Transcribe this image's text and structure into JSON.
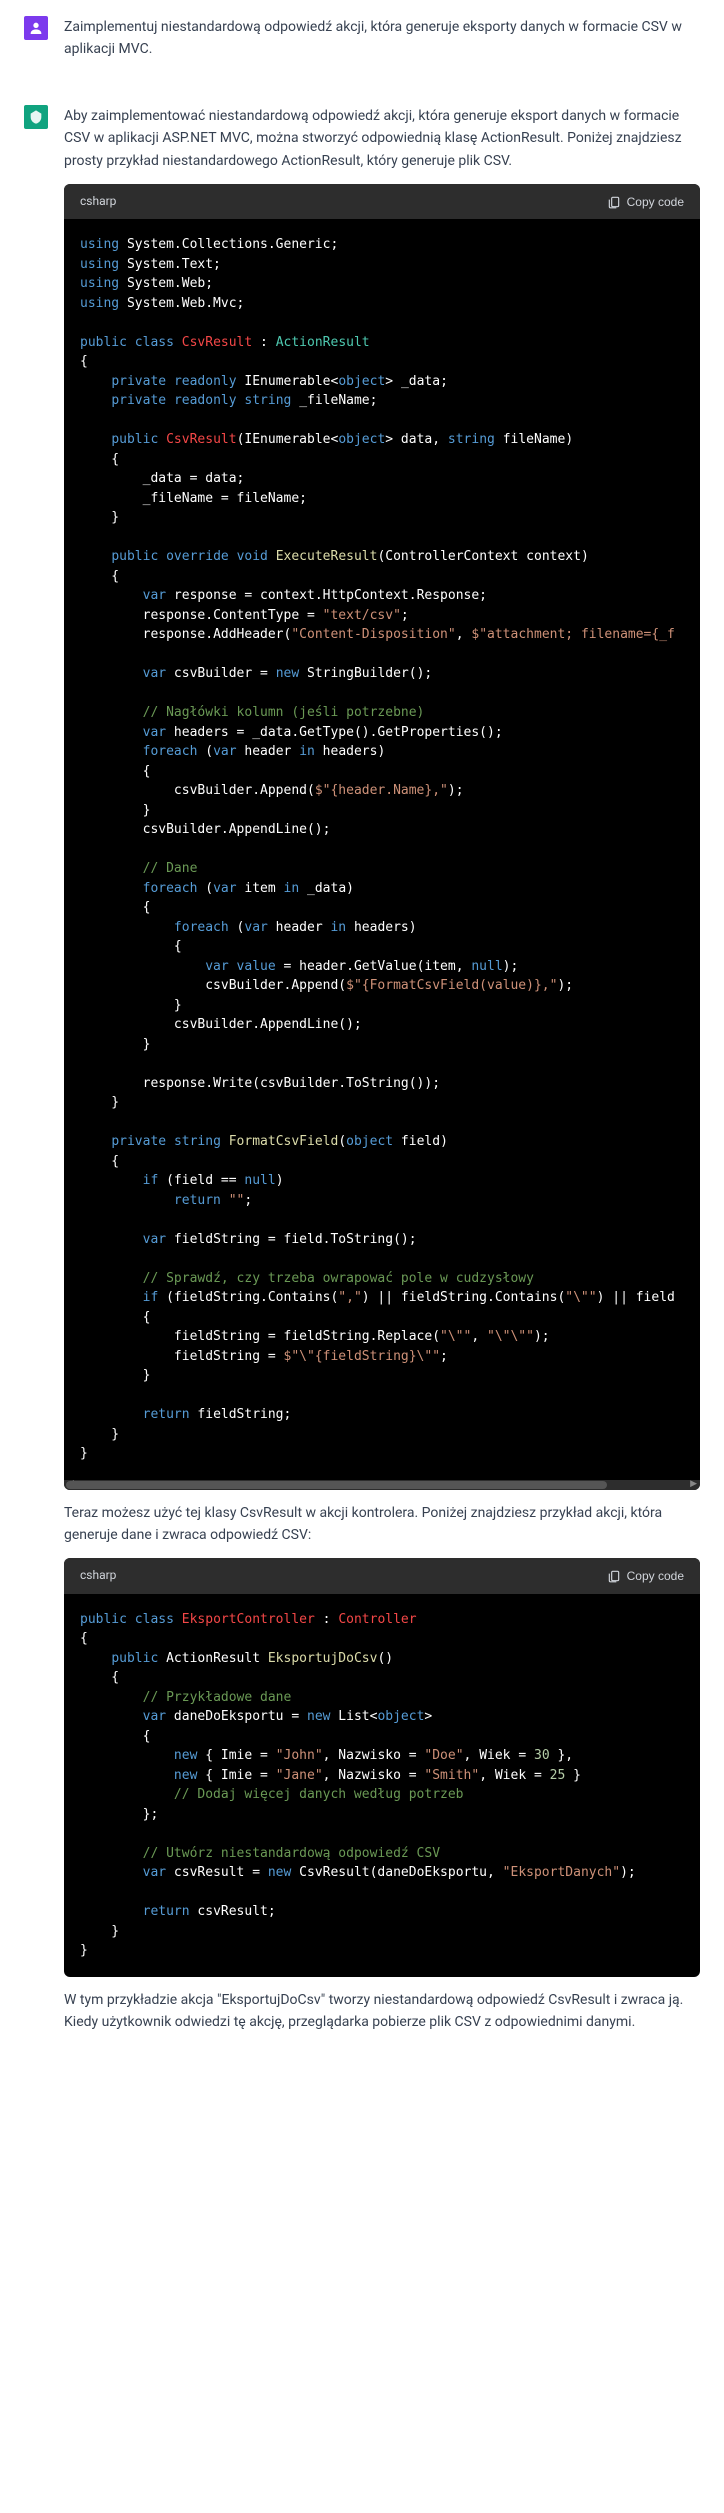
{
  "user": {
    "prompt": "Zaimplementuj niestandardową odpowiedź akcji, która generuje eksporty danych w formacie CSV w aplikacji MVC."
  },
  "assistant": {
    "intro": "Aby zaimplementować niestandardową odpowiedź akcji, która generuje eksport danych w formacie CSV w aplikacji ASP.NET MVC, można stworzyć odpowiednią klasę ActionResult. Poniżej znajdziesz prosty przykład niestandardowego ActionResult, który generuje plik CSV.",
    "mid": "Teraz możesz użyć tej klasy CsvResult w akcji kontrolera. Poniżej znajdziesz przykład akcji, która generuje dane i zwraca odpowiedź CSV:",
    "outro": "W tym przykładzie akcja \"EksportujDoCsv\" tworzy niestandardową odpowiedź CsvResult i zwraca ją. Kiedy użytkownik odwiedzi tę akcję, przeglądarka pobierze plik CSV z odpowiednimi danymi."
  },
  "code": {
    "lang": "csharp",
    "copy": "Copy code"
  },
  "code1": {
    "u1": "System.Collections.Generic;",
    "u2": "System.Text;",
    "u3": "System.Web;",
    "u4": "System.Web.Mvc;",
    "cls": "CsvResult",
    "ext": "ActionResult",
    "dataField": "_data;",
    "fileField": "_fileName;",
    "ctor": "CsvResult",
    "ctorParams": "> data, ",
    "ctorParam2": " fileName)",
    "d1": "_data = data;",
    "d2": "_fileName = fileName;",
    "exec": "ExecuteResult",
    "execParam": "(ControllerContext context)",
    "r1": " response = context.HttpContext.Response;",
    "r2": "response.ContentType = ",
    "r2s": "\"text/csv\"",
    "r3": "response.AddHeader(",
    "r3a": "\"Content-Disposition\"",
    "r3b": "$\"attachment; filename={_f",
    "sb": " csvBuilder = ",
    "sb2": " StringBuilder();",
    "c1": "// Nagłówki kolumn (jeśli potrzebne)",
    "h1": " headers = _data.GetType().GetProperties();",
    "fe1": " header ",
    "fe1b": " headers)",
    "ap1": "csvBuilder.Append(",
    "ap1s": "$\"{header.Name},\"",
    "apl": "csvBuilder.AppendLine();",
    "c2": "// Dane",
    "fe2": " item ",
    "fe2b": " _data)",
    "fe3": " header ",
    "fe3b": " headers)",
    "gv": " = header.GetValue(item, ",
    "gv2": ");",
    "ap2": "csvBuilder.Append(",
    "ap2s": "$\"{FormatCsvField(value)},\"",
    "wr": "response.Write(csvBuilder.ToString());",
    "fmt": "FormatCsvField",
    "fmtP": " field)",
    "if1": " (field == ",
    "ret1": "\"\"",
    "fs": " fieldString = field.ToString();",
    "c3": "// Sprawdź, czy trzeba owrapować pole w cudzysłowy",
    "if2": " (fieldString.Contains(",
    "if2a": "\",\"",
    "if2b": ") || fieldString.Contains(",
    "if2c": "\"\\\"\"",
    "if2d": ") || field",
    "rep": "fieldString = fieldString.Replace(",
    "repA": "\"\\\"\"",
    "repB": "\"\\\"\\\"\"",
    "asn": "fieldString = ",
    "asnS": "$\"\\\"{fieldString}\\\"\"",
    "ret2": " fieldString;"
  },
  "code2": {
    "cls": "EksportController",
    "ext": "Controller",
    "m": "EksportujDoCsv",
    "c1": "// Przykładowe dane",
    "v1": " daneDoEksportu = ",
    "v1b": " List<",
    "l1a": " { Imie = ",
    "l1b": "\"John\"",
    "l1c": ", Nazwisko = ",
    "l1d": "\"Doe\"",
    "l1e": ", Wiek = ",
    "l1f": "30",
    "l1g": " },",
    "l2b": "\"Jane\"",
    "l2d": "\"Smith\"",
    "l2f": "25",
    "l2g": " }",
    "c2": "// Dodaj więcej danych według potrzeb",
    "c3": "// Utwórz niestandardową odpowiedź CSV",
    "v2": " csvResult = ",
    "v2b": " CsvResult(daneDoEksportu, ",
    "v2c": "\"EksportDanych\"",
    "ret": " csvResult;"
  }
}
